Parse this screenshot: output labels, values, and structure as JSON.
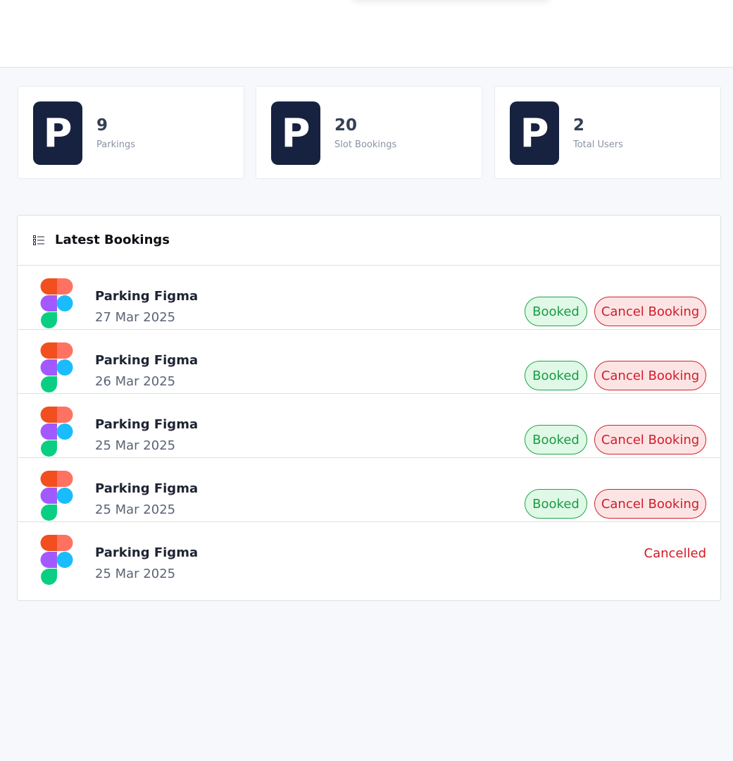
{
  "stats": [
    {
      "value": "9",
      "label": "Parkings",
      "icon_letter": "P"
    },
    {
      "value": "20",
      "label": "Slot Bookings",
      "icon_letter": "P"
    },
    {
      "value": "2",
      "label": "Total Users",
      "icon_letter": "P"
    }
  ],
  "bookings_panel": {
    "title": "Latest Bookings",
    "icon": "list-icon",
    "rows": [
      {
        "name": "Parking Figma",
        "date": "27 Mar 2025",
        "status": "Booked",
        "action": "Cancel Booking",
        "logo": "figma-logo-icon"
      },
      {
        "name": "Parking Figma",
        "date": "26 Mar 2025",
        "status": "Booked",
        "action": "Cancel Booking",
        "logo": "figma-logo-icon"
      },
      {
        "name": "Parking Figma",
        "date": "25 Mar 2025",
        "status": "Booked",
        "action": "Cancel Booking",
        "logo": "figma-logo-icon"
      },
      {
        "name": "Parking Figma",
        "date": "25 Mar 2025",
        "status": "Booked",
        "action": "Cancel Booking",
        "logo": "figma-logo-icon"
      },
      {
        "name": "Parking Figma",
        "date": "25 Mar 2025",
        "status_text": "Cancelled",
        "logo": "figma-logo-icon"
      }
    ]
  },
  "colors": {
    "stat_icon_bg": "#16223f",
    "booked_green": "#1b9a45",
    "cancel_red": "#cf1c2b",
    "page_bg": "#f7f8fb"
  }
}
